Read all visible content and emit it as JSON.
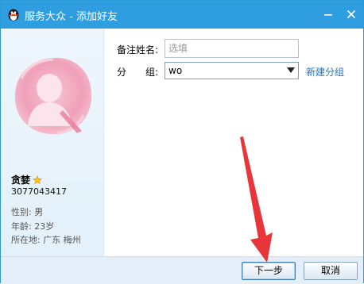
{
  "window": {
    "title": "服务大众 - 添加好友"
  },
  "profile": {
    "nickname": "贪婪",
    "qq_number": "3077043417",
    "gender": "性别: 男",
    "age": "年龄: 23岁",
    "location": "所在地: 广东  梅州"
  },
  "form": {
    "remark_label": "备注姓名:",
    "remark_placeholder": "选填",
    "group_label": "分　　组:",
    "group_value": "wo",
    "new_group_link": "新建分组"
  },
  "buttons": {
    "next": "下一步",
    "cancel": "取消"
  },
  "colors": {
    "titlebar": "#2f9ee0",
    "accent_link": "#1d74c4",
    "annotation_arrow": "#e8353a"
  }
}
